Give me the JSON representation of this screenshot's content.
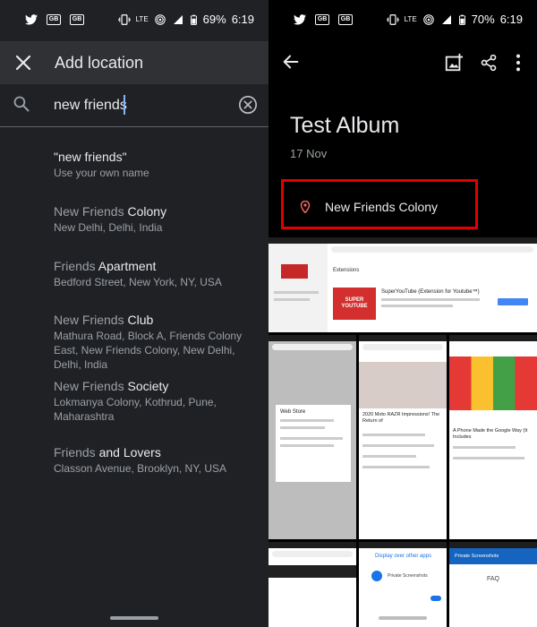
{
  "colors": {
    "left_bg": "#202124",
    "appbar": "#303134",
    "highlight_border": "#e00000",
    "pin": "#ee675c"
  },
  "left": {
    "status": {
      "battery": "69%",
      "time": "6:19",
      "icons": [
        "twitter-icon",
        "gb-icon",
        "gb-icon",
        "vibrate-icon",
        "lte-icon",
        "hotspot-icon",
        "signal-icon",
        "battery-icon"
      ]
    },
    "title": "Add location",
    "search": {
      "value": "new friends"
    },
    "results": [
      {
        "match": "\"new friends\"",
        "rest": "",
        "address": "Use your own name"
      },
      {
        "match": "New Friends",
        "rest": " Colony",
        "address": "New Delhi, Delhi, India"
      },
      {
        "match": "Friends",
        "rest": " Apartment",
        "address": "Bedford Street, New York, NY, USA"
      },
      {
        "match": "New Friends",
        "rest": " Club",
        "address": "Mathura Road, Block A, Friends Colony East, New Friends Colony, New Delhi, Delhi, India"
      },
      {
        "match": "New Friends",
        "rest": " Society",
        "address": "Lokmanya Colony, Kothrud, Pune, Maharashtra"
      },
      {
        "match": "Friends",
        "rest": " and Lovers",
        "address": "Classon Avenue, Brooklyn, NY, USA"
      }
    ]
  },
  "right": {
    "status": {
      "battery": "70%",
      "time": "6:19"
    },
    "album_title": "Test Album",
    "album_date": "17 Nov",
    "location": "New Friends Colony",
    "thumbnails": {
      "web_card_title": "SuperYouTube (Extension for Youtube™)",
      "web_card_logo": "SUPER\nYOUTUBE",
      "dialog_title": "Web Store",
      "display_over": "Display over other apps",
      "private_screenshots": "Private Screenshots",
      "faq": "FAQ",
      "moto_headline": "2020 Moto RAZR Impressions! The Return of",
      "phone_headline": "A Phone Made the Google Way (It Includes",
      "extensions_label": "Extensions"
    }
  }
}
